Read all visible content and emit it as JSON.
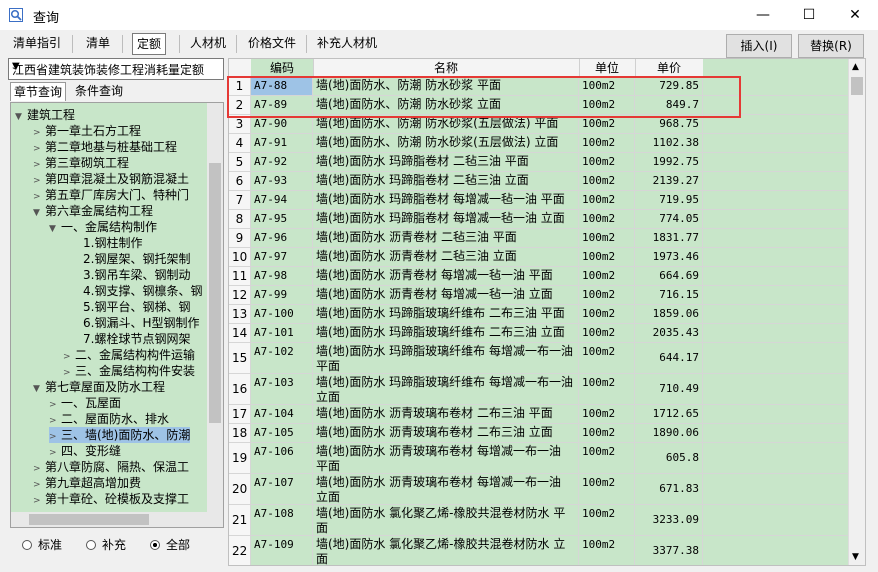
{
  "window": {
    "title": "查询",
    "minimize": "—",
    "maximize": "☐",
    "close": "✕"
  },
  "tabs": [
    {
      "label": "清单指引"
    },
    {
      "label": "清单"
    },
    {
      "label": "定额"
    },
    {
      "label": "人材机"
    },
    {
      "label": "价格文件"
    },
    {
      "label": "补充人材机"
    }
  ],
  "buttons": {
    "insert": "插入(I)",
    "replace": "替换(R)"
  },
  "left": {
    "combo_value": "江西省建筑装饰装修工程消耗量定额",
    "tabs": [
      "章节查询",
      "条件查询"
    ],
    "tree": [
      "建筑工程",
      "第一章土石方工程",
      "第二章地基与桩基础工程",
      "第三章砌筑工程",
      "第四章混凝土及钢筋混凝土",
      "第五章厂库房大门、特种门",
      "第六章金属结构工程",
      "一、金属结构制作",
      "1.钢柱制作",
      "2.钢屋架、钢托架制",
      "3.钢吊车梁、钢制动",
      "4.钢支撑、钢檩条、钢",
      "5.钢平台、钢梯、钢",
      "6.钢漏斗、H型钢制作",
      "7.螺栓球节点钢网架",
      "二、金属结构构件运输",
      "三、金属结构构件安装",
      "第七章屋面及防水工程",
      "一、瓦屋面",
      "二、屋面防水、排水",
      "三、墙(地)面防水、防潮",
      "四、变形缝",
      "第八章防腐、隔热、保温工",
      "第九章超高增加费",
      "第十章砼、砼模板及支撑工"
    ],
    "radios": [
      "标准",
      "补充",
      "全部"
    ]
  },
  "grid": {
    "headers": [
      "编码",
      "名称",
      "单位",
      "单价"
    ],
    "rows": [
      {
        "idx": "1",
        "code": "A7-88",
        "name": "墙(地)面防水、防潮 防水砂浆 平面",
        "unit": "100m2",
        "price": "729.85"
      },
      {
        "idx": "2",
        "code": "A7-89",
        "name": "墙(地)面防水、防潮 防水砂浆 立面",
        "unit": "100m2",
        "price": "849.7"
      },
      {
        "idx": "3",
        "code": "A7-90",
        "name": "墙(地)面防水、防潮 防水砂浆(五层做法) 平面",
        "unit": "100m2",
        "price": "968.75"
      },
      {
        "idx": "4",
        "code": "A7-91",
        "name": "墙(地)面防水、防潮 防水砂浆(五层做法) 立面",
        "unit": "100m2",
        "price": "1102.38"
      },
      {
        "idx": "5",
        "code": "A7-92",
        "name": "墙(地)面防水 玛蹄脂卷材 二毡三油 平面",
        "unit": "100m2",
        "price": "1992.75"
      },
      {
        "idx": "6",
        "code": "A7-93",
        "name": "墙(地)面防水 玛蹄脂卷材 二毡三油 立面",
        "unit": "100m2",
        "price": "2139.27"
      },
      {
        "idx": "7",
        "code": "A7-94",
        "name": "墙(地)面防水 玛蹄脂卷材 每增减一毡一油 平面",
        "unit": "100m2",
        "price": "719.95"
      },
      {
        "idx": "8",
        "code": "A7-95",
        "name": "墙(地)面防水 玛蹄脂卷材 每增减一毡一油 立面",
        "unit": "100m2",
        "price": "774.05"
      },
      {
        "idx": "9",
        "code": "A7-96",
        "name": "墙(地)面防水 沥青卷材 二毡三油 平面",
        "unit": "100m2",
        "price": "1831.77"
      },
      {
        "idx": "10",
        "code": "A7-97",
        "name": "墙(地)面防水 沥青卷材 二毡三油 立面",
        "unit": "100m2",
        "price": "1973.46"
      },
      {
        "idx": "11",
        "code": "A7-98",
        "name": "墙(地)面防水 沥青卷材 每增减一毡一油 平面",
        "unit": "100m2",
        "price": "664.69"
      },
      {
        "idx": "12",
        "code": "A7-99",
        "name": "墙(地)面防水 沥青卷材 每增减一毡一油 立面",
        "unit": "100m2",
        "price": "716.15"
      },
      {
        "idx": "13",
        "code": "A7-100",
        "name": "墙(地)面防水 玛蹄脂玻璃纤维布 二布三油 平面",
        "unit": "100m2",
        "price": "1859.06"
      },
      {
        "idx": "14",
        "code": "A7-101",
        "name": "墙(地)面防水 玛蹄脂玻璃纤维布 二布三油 立面",
        "unit": "100m2",
        "price": "2035.43"
      },
      {
        "idx": "15",
        "code": "A7-102",
        "name": "墙(地)面防水 玛蹄脂玻璃纤维布 每增减一布一油 平面",
        "unit": "100m2",
        "price": "644.17"
      },
      {
        "idx": "16",
        "code": "A7-103",
        "name": "墙(地)面防水 玛蹄脂玻璃纤维布 每增减一布一油 立面",
        "unit": "100m2",
        "price": "710.49"
      },
      {
        "idx": "17",
        "code": "A7-104",
        "name": "墙(地)面防水 沥青玻璃布卷材 二布三油 平面",
        "unit": "100m2",
        "price": "1712.65"
      },
      {
        "idx": "18",
        "code": "A7-105",
        "name": "墙(地)面防水 沥青玻璃布卷材 二布三油 立面",
        "unit": "100m2",
        "price": "1890.06"
      },
      {
        "idx": "19",
        "code": "A7-106",
        "name": "墙(地)面防水 沥青玻璃布卷材 每增减一布一油 平面",
        "unit": "100m2",
        "price": "605.8"
      },
      {
        "idx": "20",
        "code": "A7-107",
        "name": "墙(地)面防水 沥青玻璃布卷材 每增减一布一油 立面",
        "unit": "100m2",
        "price": "671.83"
      },
      {
        "idx": "21",
        "code": "A7-108",
        "name": "墙(地)面防水 氯化聚乙烯-橡胶共混卷材防水 平面",
        "unit": "100m2",
        "price": "3233.09"
      },
      {
        "idx": "22",
        "code": "A7-109",
        "name": "墙(地)面防水 氯化聚乙烯-橡胶共混卷材防水 立面",
        "unit": "100m2",
        "price": "3377.38"
      }
    ]
  },
  "colors": {
    "highlight_box": "#e53935",
    "green_bg": "#c8e6c9"
  }
}
